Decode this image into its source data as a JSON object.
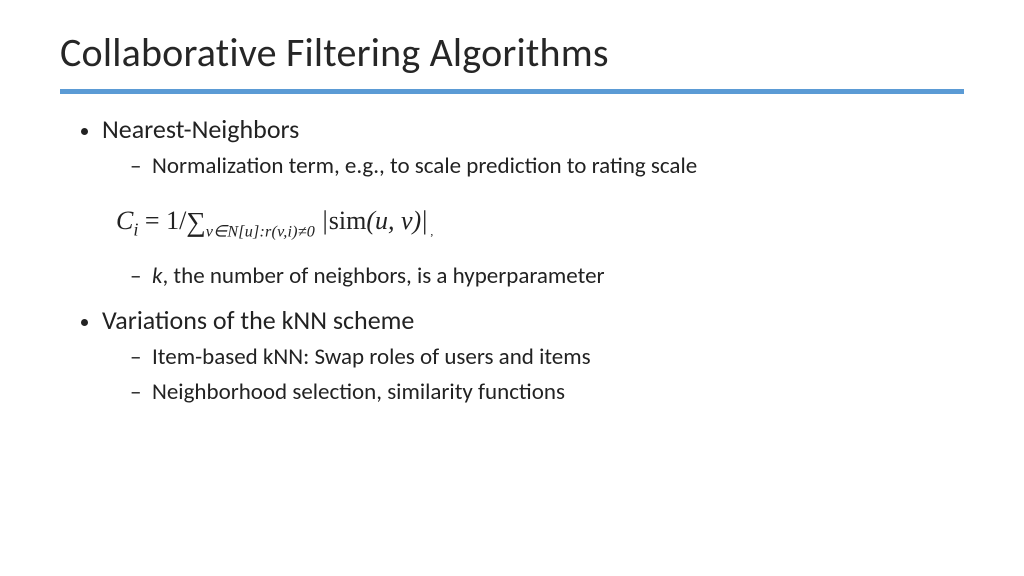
{
  "title": "Collaborative Filtering Algorithms",
  "bullets": {
    "b1": {
      "label": "Nearest-Neighbors",
      "sub1": "Normalization term, e.g., to scale prediction to rating scale",
      "sub2_prefix": "k",
      "sub2_rest": ", the number of of neighbors, is a hyperparameter"
    },
    "b2": {
      "label": "Variations of the kNN scheme",
      "sub1": "Item-based kNN: Swap roles of users and items",
      "sub2": "Neighborhood selection, similarity functions"
    }
  },
  "formula": {
    "lhs_var": "C",
    "lhs_sub": "i",
    "eq": " = 1/",
    "sum_sub": "v∈N[u]:r(v,i)≠0",
    "sim_fn": "sim",
    "sim_args": "(u, v)",
    "needs_fix_sub2": ", the number of neighbors, is a hyperparameter"
  }
}
